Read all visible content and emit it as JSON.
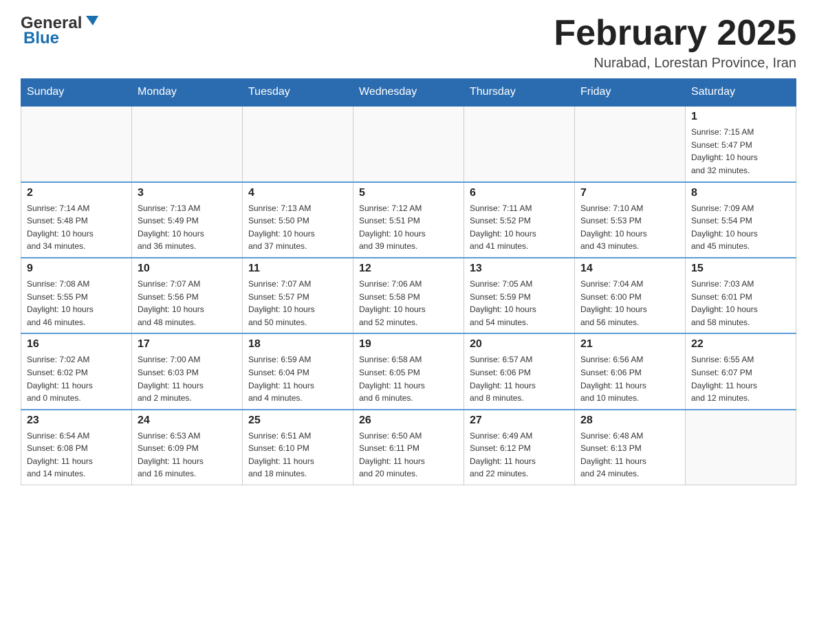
{
  "header": {
    "logo": {
      "text_general": "General",
      "text_blue": "Blue"
    },
    "title": "February 2025",
    "subtitle": "Nurabad, Lorestan Province, Iran"
  },
  "weekdays": [
    "Sunday",
    "Monday",
    "Tuesday",
    "Wednesday",
    "Thursday",
    "Friday",
    "Saturday"
  ],
  "weeks": [
    [
      {
        "day": "",
        "info": ""
      },
      {
        "day": "",
        "info": ""
      },
      {
        "day": "",
        "info": ""
      },
      {
        "day": "",
        "info": ""
      },
      {
        "day": "",
        "info": ""
      },
      {
        "day": "",
        "info": ""
      },
      {
        "day": "1",
        "info": "Sunrise: 7:15 AM\nSunset: 5:47 PM\nDaylight: 10 hours\nand 32 minutes."
      }
    ],
    [
      {
        "day": "2",
        "info": "Sunrise: 7:14 AM\nSunset: 5:48 PM\nDaylight: 10 hours\nand 34 minutes."
      },
      {
        "day": "3",
        "info": "Sunrise: 7:13 AM\nSunset: 5:49 PM\nDaylight: 10 hours\nand 36 minutes."
      },
      {
        "day": "4",
        "info": "Sunrise: 7:13 AM\nSunset: 5:50 PM\nDaylight: 10 hours\nand 37 minutes."
      },
      {
        "day": "5",
        "info": "Sunrise: 7:12 AM\nSunset: 5:51 PM\nDaylight: 10 hours\nand 39 minutes."
      },
      {
        "day": "6",
        "info": "Sunrise: 7:11 AM\nSunset: 5:52 PM\nDaylight: 10 hours\nand 41 minutes."
      },
      {
        "day": "7",
        "info": "Sunrise: 7:10 AM\nSunset: 5:53 PM\nDaylight: 10 hours\nand 43 minutes."
      },
      {
        "day": "8",
        "info": "Sunrise: 7:09 AM\nSunset: 5:54 PM\nDaylight: 10 hours\nand 45 minutes."
      }
    ],
    [
      {
        "day": "9",
        "info": "Sunrise: 7:08 AM\nSunset: 5:55 PM\nDaylight: 10 hours\nand 46 minutes."
      },
      {
        "day": "10",
        "info": "Sunrise: 7:07 AM\nSunset: 5:56 PM\nDaylight: 10 hours\nand 48 minutes."
      },
      {
        "day": "11",
        "info": "Sunrise: 7:07 AM\nSunset: 5:57 PM\nDaylight: 10 hours\nand 50 minutes."
      },
      {
        "day": "12",
        "info": "Sunrise: 7:06 AM\nSunset: 5:58 PM\nDaylight: 10 hours\nand 52 minutes."
      },
      {
        "day": "13",
        "info": "Sunrise: 7:05 AM\nSunset: 5:59 PM\nDaylight: 10 hours\nand 54 minutes."
      },
      {
        "day": "14",
        "info": "Sunrise: 7:04 AM\nSunset: 6:00 PM\nDaylight: 10 hours\nand 56 minutes."
      },
      {
        "day": "15",
        "info": "Sunrise: 7:03 AM\nSunset: 6:01 PM\nDaylight: 10 hours\nand 58 minutes."
      }
    ],
    [
      {
        "day": "16",
        "info": "Sunrise: 7:02 AM\nSunset: 6:02 PM\nDaylight: 11 hours\nand 0 minutes."
      },
      {
        "day": "17",
        "info": "Sunrise: 7:00 AM\nSunset: 6:03 PM\nDaylight: 11 hours\nand 2 minutes."
      },
      {
        "day": "18",
        "info": "Sunrise: 6:59 AM\nSunset: 6:04 PM\nDaylight: 11 hours\nand 4 minutes."
      },
      {
        "day": "19",
        "info": "Sunrise: 6:58 AM\nSunset: 6:05 PM\nDaylight: 11 hours\nand 6 minutes."
      },
      {
        "day": "20",
        "info": "Sunrise: 6:57 AM\nSunset: 6:06 PM\nDaylight: 11 hours\nand 8 minutes."
      },
      {
        "day": "21",
        "info": "Sunrise: 6:56 AM\nSunset: 6:06 PM\nDaylight: 11 hours\nand 10 minutes."
      },
      {
        "day": "22",
        "info": "Sunrise: 6:55 AM\nSunset: 6:07 PM\nDaylight: 11 hours\nand 12 minutes."
      }
    ],
    [
      {
        "day": "23",
        "info": "Sunrise: 6:54 AM\nSunset: 6:08 PM\nDaylight: 11 hours\nand 14 minutes."
      },
      {
        "day": "24",
        "info": "Sunrise: 6:53 AM\nSunset: 6:09 PM\nDaylight: 11 hours\nand 16 minutes."
      },
      {
        "day": "25",
        "info": "Sunrise: 6:51 AM\nSunset: 6:10 PM\nDaylight: 11 hours\nand 18 minutes."
      },
      {
        "day": "26",
        "info": "Sunrise: 6:50 AM\nSunset: 6:11 PM\nDaylight: 11 hours\nand 20 minutes."
      },
      {
        "day": "27",
        "info": "Sunrise: 6:49 AM\nSunset: 6:12 PM\nDaylight: 11 hours\nand 22 minutes."
      },
      {
        "day": "28",
        "info": "Sunrise: 6:48 AM\nSunset: 6:13 PM\nDaylight: 11 hours\nand 24 minutes."
      },
      {
        "day": "",
        "info": ""
      }
    ]
  ]
}
